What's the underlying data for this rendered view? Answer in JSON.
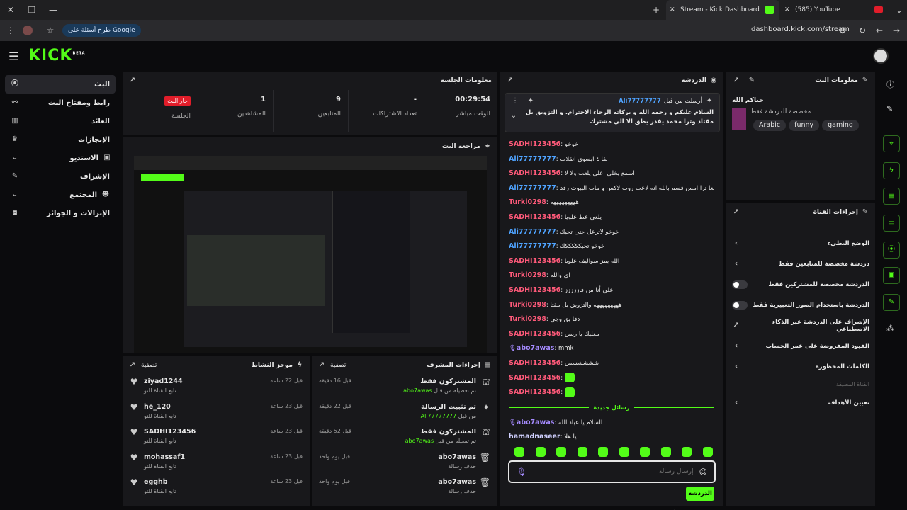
{
  "browser": {
    "tabs": [
      {
        "title": "Stream - Kick Dashboard",
        "active": true
      },
      {
        "title": "(585) YouTube",
        "active": false
      }
    ],
    "google_pill": "طرح أسئلة على Google",
    "url": "dashboard.kick.com/stream"
  },
  "app": {
    "logo": "KICK",
    "logo_beta": "BETA"
  },
  "sidebar": {
    "items": [
      {
        "label": "البث",
        "icon": "broadcast-icon",
        "active": true
      },
      {
        "label": "رابط ومفتاح البث",
        "icon": "link-icon"
      },
      {
        "label": "العائد",
        "icon": "revenue-icon"
      },
      {
        "label": "الإنجازات",
        "icon": "trophy-icon"
      },
      {
        "label": "الاستديو",
        "icon": "studio-icon",
        "expandable": true
      },
      {
        "label": "الإشراف",
        "icon": "wrench-icon"
      },
      {
        "label": "المجتمع",
        "icon": "community-icon",
        "expandable": true
      },
      {
        "label": "الإنزالات و الجوائز",
        "icon": "gift-drop-icon"
      }
    ]
  },
  "session": {
    "title": "معلومات الجلسة",
    "stats": [
      {
        "value": "00:29:54",
        "label": "الوقت مباشر"
      },
      {
        "value": "-",
        "label": "تعداد الاشتراكات"
      },
      {
        "value": "9",
        "label": "المتابعين"
      },
      {
        "value": "1",
        "label": "المشاهدين"
      },
      {
        "value": "جار البث",
        "label": "الجلسة",
        "badge": true
      }
    ]
  },
  "preview": {
    "title": "مراجعة البث"
  },
  "activity": {
    "title": "موجز النشاط",
    "filter": "تصفية",
    "rows": [
      {
        "name": "ziyad1244",
        "sub": "تابع القناة للتو",
        "time": "قبل 22 ساعة"
      },
      {
        "name": "he_120",
        "sub": "تابع القناة للتو",
        "time": "قبل 23 ساعة"
      },
      {
        "name": "SADHI123456",
        "sub": "تابع القناة للتو",
        "time": "قبل 23 ساعة"
      },
      {
        "name": "mohassaf1",
        "sub": "تابع القناة للتو",
        "time": "قبل 23 ساعة"
      },
      {
        "name": "egghb",
        "sub": "تابع القناة للتو",
        "time": "قبل 23 ساعة"
      }
    ]
  },
  "modactions": {
    "title": "إجراءات المشرف",
    "filter": "تصفية",
    "rows": [
      {
        "name": "المشتركون فقط",
        "sub": "تم تعطيله من قبل",
        "user": "abo7awas",
        "time": "قبل 16 دقيقة",
        "icon": "gift-icon"
      },
      {
        "name": "تم تثبيت الرسالة",
        "sub": "من قبل",
        "user": "Ali77777777",
        "time": "قبل 22 دقيقة",
        "icon": "pin-icon"
      },
      {
        "name": "المشتركون فقط",
        "sub": "تم تفعيله من قبل",
        "user": "abo7awas",
        "time": "قبل 52 دقيقة",
        "icon": "gift-icon"
      },
      {
        "name": "abo7awas",
        "sub": "حذف رسالة",
        "user": "",
        "time": "قبل يوم واحد",
        "icon": "trash-icon"
      },
      {
        "name": "abo7awas",
        "sub": "حذف رسالة",
        "user": "",
        "time": "قبل يوم واحد",
        "icon": "trash-icon"
      }
    ]
  },
  "chat": {
    "title": "الدردشة",
    "pinned": {
      "label": "أرسلت من قبل",
      "user": "Ali77777777",
      "text": "السلام عليكم و رحمه الله و بركاته الرجاء الاحترام. و التزويق بل مقتاد وترا محمد يقدر يطق الا الي مشترك"
    },
    "messages": [
      {
        "user": "SADHI123456",
        "color": "pink",
        "text": "خوخو"
      },
      {
        "user": "Ali77777777",
        "color": "cyan",
        "text": "بقا ٤ ابسوي انقلاب"
      },
      {
        "user": "SADHI123456",
        "color": "pink",
        "text": "اسمع يخلي اعلي يلعب ولا لا"
      },
      {
        "user": "Ali77777777",
        "color": "cyan",
        "text": "طبعا ترا امس قسم بالله انه لاعب روب لاكس و ماب البيوت رقد"
      },
      {
        "user": "Turki0298",
        "color": "pink",
        "text": "هههههههههه"
      },
      {
        "user": "SADHI123456",
        "color": "pink",
        "text": "يلعي عط علويا"
      },
      {
        "user": "Ali77777777",
        "color": "cyan",
        "text": "خوخو لاتزعل حتى تحبك"
      },
      {
        "user": "Ali77777777",
        "color": "cyan",
        "text": "خوخو تحبكككككك"
      },
      {
        "user": "SADHI123456",
        "color": "pink",
        "text": "الله يمز سواليف علويا"
      },
      {
        "user": "Turki0298",
        "color": "pink",
        "text": "اي والله"
      },
      {
        "user": "SADHI123456",
        "color": "pink",
        "text": "علي أنا من فاززززز"
      },
      {
        "user": "Turki0298",
        "color": "pink",
        "text": "هههههههههه والتزويق بل مقتا"
      },
      {
        "user": "Turki0298",
        "color": "pink",
        "text": "دقا يق وجي"
      },
      {
        "user": "SADHI123456",
        "color": "pink",
        "text": "معليك يا ريس"
      },
      {
        "user": "abo7awas",
        "color": "purple",
        "text": "mmk"
      },
      {
        "user": "SADHI123456",
        "color": "pink",
        "text": "ششششسس"
      },
      {
        "user": "SADHI123456",
        "color": "pink",
        "text": ""
      },
      {
        "user": "SADHI123456",
        "color": "pink",
        "text": ""
      }
    ],
    "new_divider": "رسائل جديدة",
    "new_messages": [
      {
        "user": "abo7awas",
        "color": "purple",
        "text": "السلام يا عباد الله"
      },
      {
        "user": "hamadnaseer",
        "color": "light",
        "text": "يا هلا"
      }
    ],
    "input_placeholder": "إرسال رسالة",
    "send": "الدردشة"
  },
  "stream_info": {
    "title": "معلومات البث",
    "stream_title": "حياكم الله",
    "category": "مخصصة للدردشة فقط",
    "tags": [
      "Arabic",
      "funny",
      "gaming"
    ]
  },
  "channel_actions": {
    "title": "إجراءات القناة",
    "rows": [
      {
        "label": "الوضع البطيء",
        "control": "chevron"
      },
      {
        "label": "دردشة مخصصة للمتابعين فقط",
        "control": "chevron"
      },
      {
        "label": "الدردشة مخصصة للمشتركين فقط",
        "control": "toggle"
      },
      {
        "label": "الدردشة باستخدام الصور التعبيرية فقط",
        "control": "toggle"
      },
      {
        "label": "الإشراف على الدردشة عبر الذكاء الاصطناعي",
        "control": "external"
      },
      {
        "label": "القيود المفروضة على عمر الحساب",
        "control": "chevron"
      },
      {
        "label": "الكلمات المحظورة",
        "control": "chevron"
      }
    ],
    "hosted_label": "القناة المضيفة",
    "goals": "تعيين الأهداف"
  }
}
